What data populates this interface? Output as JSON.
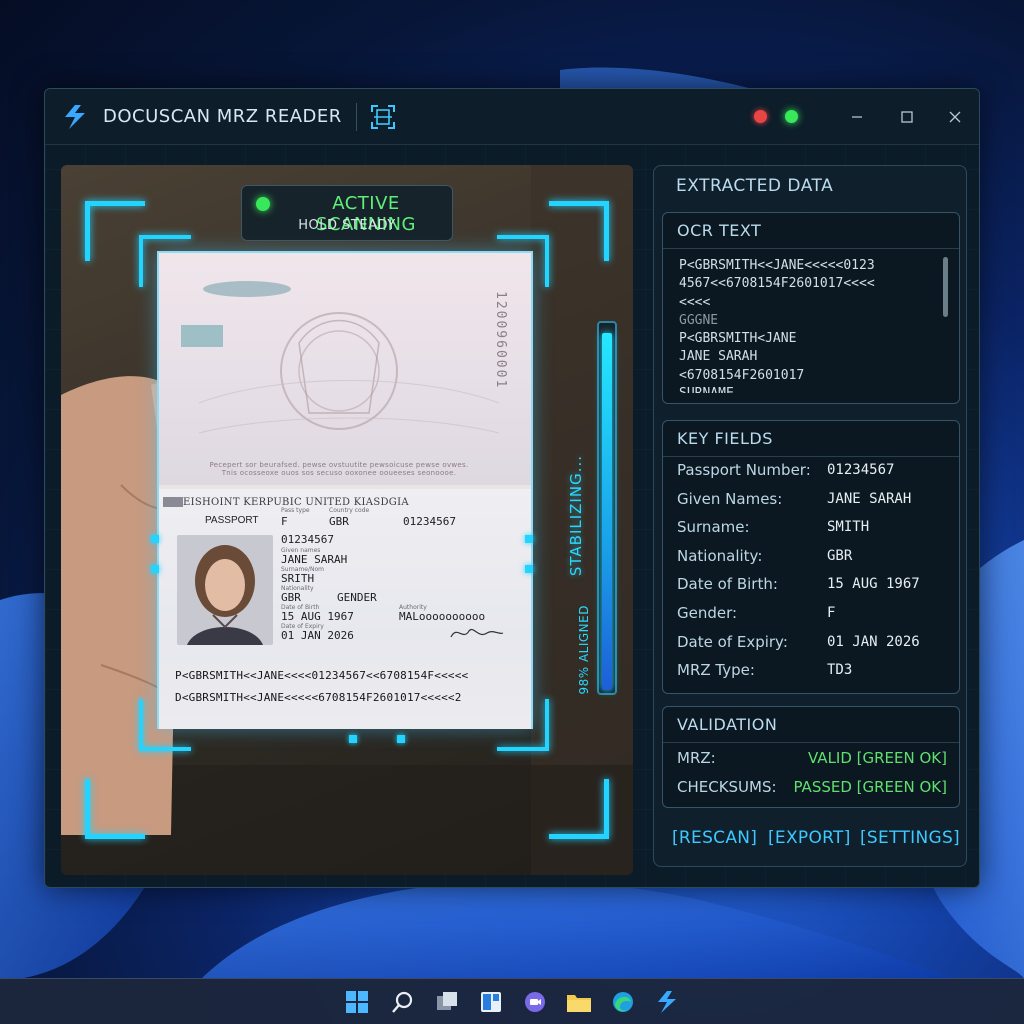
{
  "app": {
    "title": "DOCUSCAN MRZ READER"
  },
  "camera": {
    "status_main": "ACTIVE SCANNING",
    "status_sub": "HOLD STEADY",
    "stabilizing": "STABILIZING...",
    "aligned_label": "98% ALIGNED",
    "aligned_fraction": 0.98,
    "passport": {
      "serial": "1200960001",
      "upper_caption": "Pecepert sor beurafsed. pewse ovstuutite pewsoicuse pewse ovwes. Tnis ocosseoxe ouos sos secuso ooxonee ooueeses seonoooe.",
      "header": "EISHOINT KERPUBIC UNITED KIASDGIA",
      "type": "PASSPORT",
      "type_code": "F",
      "country_code": "GBR",
      "doc_number_top": "01234567",
      "doc_number": "01234567",
      "given_names": "JANE SARAH",
      "surname": "SRITH",
      "nationality": "GBR",
      "gender_label": "GENDER",
      "dob": "15 AUG 1967",
      "expiry": "01 JAN 2026",
      "place": "MALoooooooooo",
      "lbl_pass_type": "Pass type",
      "lbl_country": "Country code",
      "lbl_given": "Given names",
      "lbl_surname": "Surname/Nom",
      "lbl_nationality": "Nationality",
      "lbl_dob": "Date of Birth",
      "lbl_expiry": "Date of Expiry",
      "lbl_authority": "Authority",
      "mrz_line1": "P<GBRSMITH<<JANE<<<<01234567<<6708154F<<<<<",
      "mrz_line2": "D<GBRSMITH<<JANE<<<<<6708154F2601017<<<<<2"
    }
  },
  "panel": {
    "title": "EXTRACTED DATA",
    "ocr": {
      "title": "OCR TEXT",
      "lines": [
        {
          "text": "P<GBRSMITH<<JANE<<<<<0123",
          "muted": false
        },
        {
          "text": "4567<<6708154F2601017<<<<",
          "muted": false
        },
        {
          "text": "<<<<",
          "muted": false
        },
        {
          "text": "GGGNE",
          "muted": true
        },
        {
          "text": "P<GBRSMITH<JANE",
          "muted": false
        },
        {
          "text": "JANE SARAH",
          "muted": false
        },
        {
          "text": "<6708154F2601017",
          "muted": false
        },
        {
          "text": "SURNAME",
          "muted": false
        }
      ]
    },
    "key_fields": {
      "title": "KEY FIELDS",
      "rows": [
        {
          "label": "Passport Number:",
          "value": "01234567"
        },
        {
          "label": "Given Names:",
          "value": "JANE SARAH"
        },
        {
          "label": "Surname:",
          "value": "SMITH"
        },
        {
          "label": "Nationality:",
          "value": "GBR"
        },
        {
          "label": "Date of Birth:",
          "value": "15 AUG 1967"
        },
        {
          "label": "Gender:",
          "value": "F"
        },
        {
          "label": "Date of Expiry:",
          "value": "01 JAN 2026"
        },
        {
          "label": "MRZ Type:",
          "value": "TD3"
        }
      ]
    },
    "validation": {
      "title": "VALIDATION",
      "rows": [
        {
          "label": "MRZ:",
          "value": "VALID [GREEN OK]"
        },
        {
          "label": "CHECKSUMS:",
          "value": "PASSED [GREEN OK]"
        }
      ]
    },
    "actions": {
      "rescan": "[RESCAN]",
      "export": "[EXPORT]",
      "settings": "[SETTINGS]"
    }
  },
  "colors": {
    "accent": "#22d4ff",
    "ok_green": "#5fe06e",
    "status_green": "#39e85a",
    "close_red": "#e84545"
  },
  "taskbar": {
    "icons": [
      "windows-start-icon",
      "search-icon",
      "task-view-icon",
      "widgets-icon",
      "chat-icon",
      "file-explorer-icon",
      "edge-browser-icon",
      "docuscan-app-icon"
    ]
  }
}
